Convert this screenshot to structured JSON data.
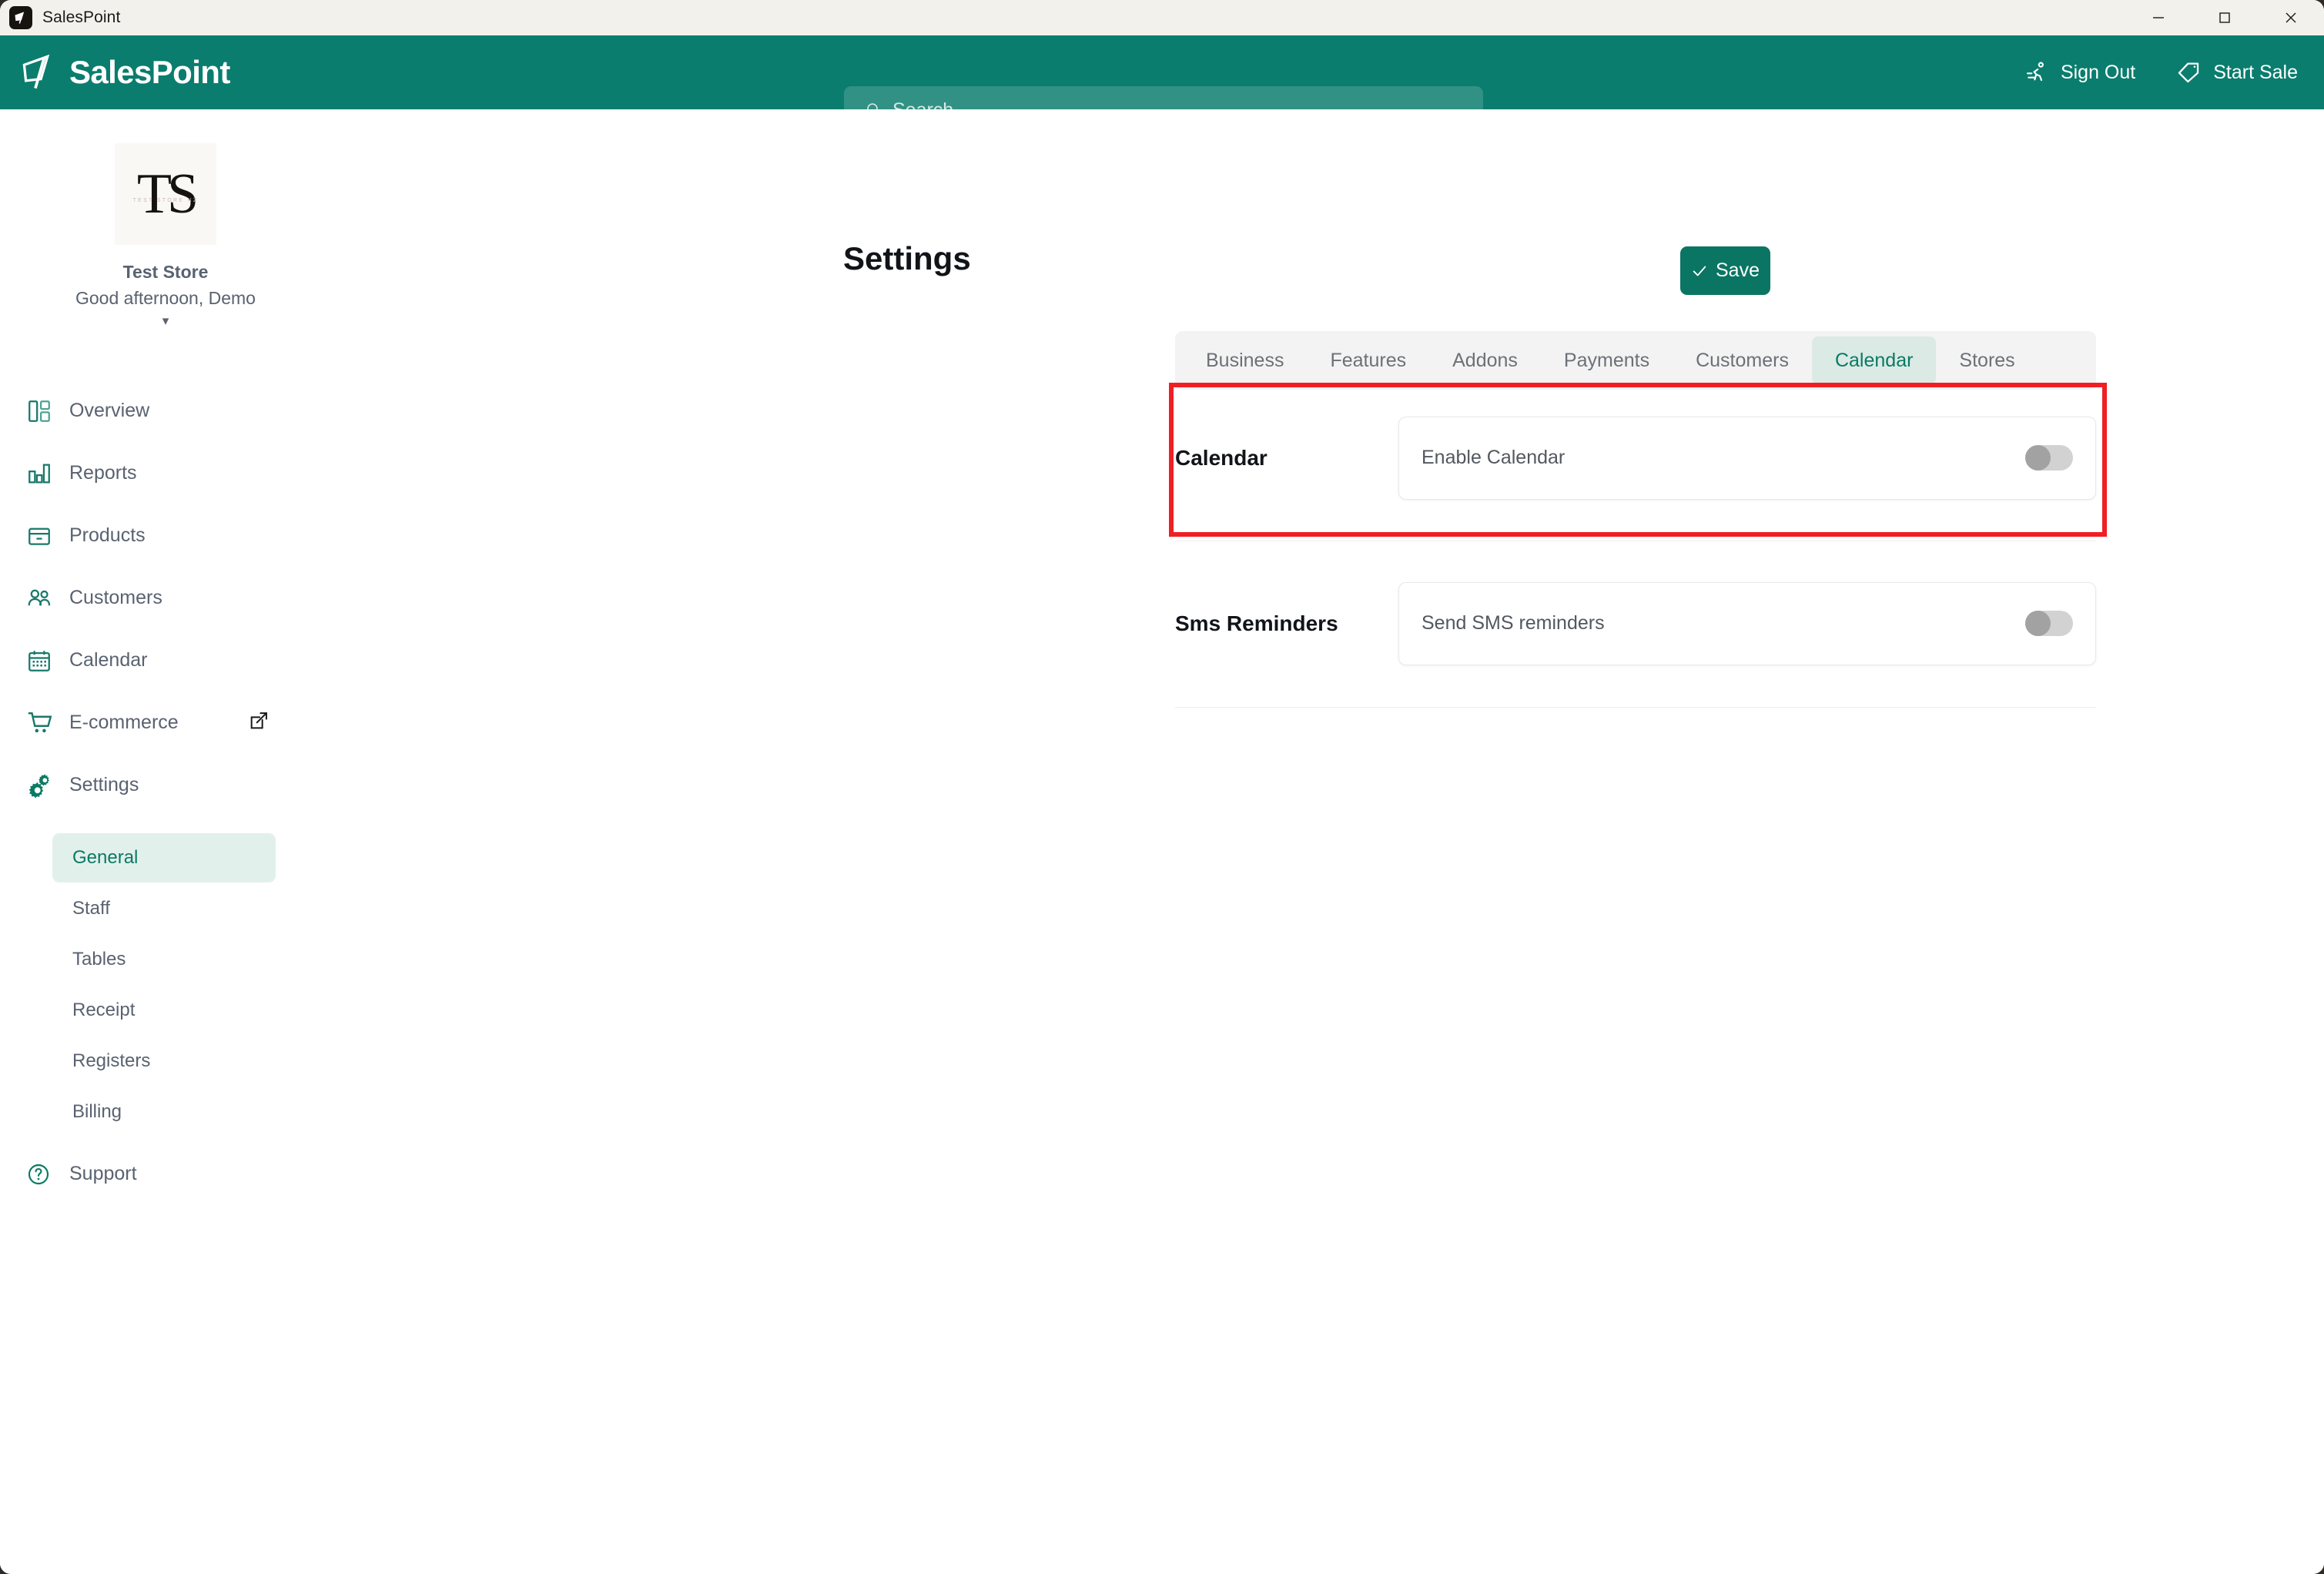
{
  "window": {
    "app_title": "SalesPoint",
    "controls": {
      "minimize": "—",
      "maximize": "□",
      "close": "✕"
    }
  },
  "header": {
    "brand": "SalesPoint",
    "search_placeholder": "Search",
    "actions": [
      {
        "label": "Sign Out",
        "icon": "running-person-icon"
      },
      {
        "label": "Start Sale",
        "icon": "tag-icon"
      }
    ]
  },
  "sidebar": {
    "store": {
      "logo_initials": "TS",
      "logo_subtext": "TEST STORE NZ",
      "name": "Test Store",
      "greeting": "Good afternoon, Demo",
      "caret": "▾"
    },
    "nav": [
      {
        "label": "Overview",
        "icon": "dashboard-icon"
      },
      {
        "label": "Reports",
        "icon": "bar-chart-icon"
      },
      {
        "label": "Products",
        "icon": "box-icon"
      },
      {
        "label": "Customers",
        "icon": "people-icon"
      },
      {
        "label": "Calendar",
        "icon": "calendar-icon"
      },
      {
        "label": "E-commerce",
        "icon": "shopping-cart-icon",
        "external": true
      },
      {
        "label": "Settings",
        "icon": "gears-icon"
      }
    ],
    "settings_submenu": [
      {
        "label": "General",
        "active": true
      },
      {
        "label": "Staff",
        "active": false
      },
      {
        "label": "Tables",
        "active": false
      },
      {
        "label": "Receipt",
        "active": false
      },
      {
        "label": "Registers",
        "active": false
      },
      {
        "label": "Billing",
        "active": false
      }
    ],
    "support": {
      "label": "Support",
      "icon": "question-circle-icon"
    }
  },
  "main": {
    "page_title": "Settings",
    "save_label": "Save",
    "tabs": [
      {
        "label": "Business",
        "active": false
      },
      {
        "label": "Features",
        "active": false
      },
      {
        "label": "Addons",
        "active": false
      },
      {
        "label": "Payments",
        "active": false
      },
      {
        "label": "Customers",
        "active": false
      },
      {
        "label": "Calendar",
        "active": true
      },
      {
        "label": "Stores",
        "active": false
      }
    ],
    "sections": [
      {
        "label": "Calendar",
        "row_label": "Enable Calendar",
        "toggle_state": "off",
        "highlighted": true
      },
      {
        "label": "Sms Reminders",
        "row_label": "Send SMS reminders",
        "toggle_state": "off",
        "highlighted": false
      }
    ]
  },
  "colors": {
    "brand_teal": "#0a7d6e",
    "save_green": "#0a7563",
    "active_tab_bg": "#dbeae5",
    "active_tab_text": "#0a7a63",
    "highlight_red": "#ef1f24",
    "titlebar_bg": "#f3f1ec",
    "toggle_track_off": "#d2d2d2",
    "toggle_knob_off": "#a2a2a2"
  }
}
